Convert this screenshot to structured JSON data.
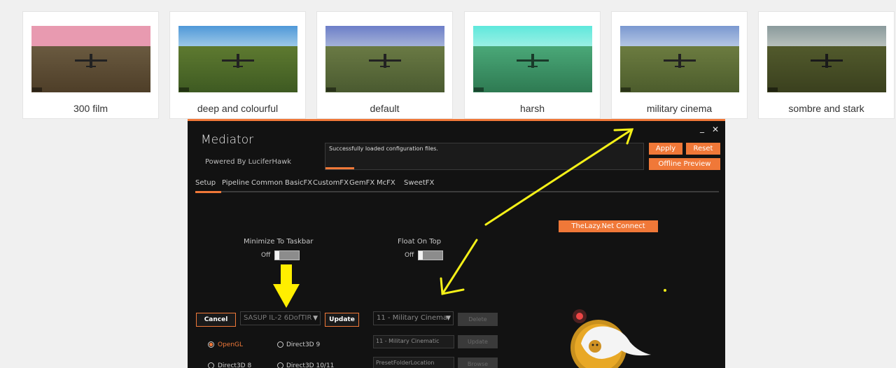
{
  "gallery": [
    {
      "caption": "300 film",
      "sky": "#e89ab0",
      "ground": "#5a4a32"
    },
    {
      "caption": "deep and colourful",
      "sky": "#6fb0df",
      "ground": "#4f6a2a"
    },
    {
      "caption": "default",
      "sky": "#7d8fcc",
      "ground": "#5e6e3c"
    },
    {
      "caption": "harsh",
      "sky": "#6ee8d8",
      "ground": "#3f9a6a"
    },
    {
      "caption": "military cinema",
      "sky": "#8aa8d8",
      "ground": "#607238"
    },
    {
      "caption": "sombre and stark",
      "sky": "#98a8a8",
      "ground": "#4a5228"
    }
  ],
  "app": {
    "title": "Mediator",
    "subtitle": "Powered By LuciferHawk",
    "minimize_icon": "_",
    "close_icon": "✕",
    "status_text": "Successfully loaded configuration files.",
    "status_progress": 0.09,
    "apply": "Apply",
    "reset": "Reset",
    "offline_preview": "Offline Preview",
    "accent": "#f07838"
  },
  "tabs": [
    "Setup",
    "Pipeline",
    "Common",
    "BasicFX",
    "CustomFX",
    "GemFX",
    "McFX",
    "SweetFX"
  ],
  "setup": {
    "minimize_label": "Minimize To Taskbar",
    "minimize_state": "Off",
    "float_label": "Float On Top",
    "float_state": "Off",
    "lazy_connect": "TheLazy.Net Connect",
    "cancel": "Cancel",
    "game_profile": "SASUP IL-2 6DofTIR",
    "update": "Update",
    "preset_selected": "11 - Military Cinema",
    "delete": "Delete",
    "preset_name": "11 - Military Cinematic",
    "update2": "Update",
    "folder_placeholder": "PresetFolderLocation",
    "browse": "Browse",
    "renderers": [
      "OpenGL",
      "Direct3D 9",
      "Direct3D 8",
      "Direct3D 10/11"
    ],
    "renderer_selected": "OpenGL"
  }
}
